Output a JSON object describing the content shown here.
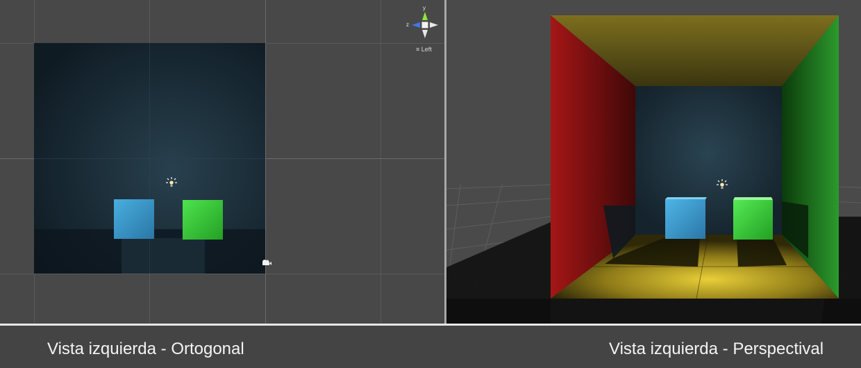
{
  "captions": {
    "left": "Vista izquierda - Ortogonal",
    "right": "Vista izquierda - Perspectival"
  },
  "gizmo": {
    "y_label": "y",
    "z_label": "z",
    "view_label": "Left",
    "view_menu_icon": "hamburger-menu-icon"
  },
  "colors": {
    "left_wall": "#a01414",
    "right_wall": "#1f8a1f",
    "ceiling_floor": "#d4b52a",
    "back_wall": "#1d3340",
    "blue_cube": "#3a9ad0",
    "green_cube": "#3fc43f",
    "gizmo_y": "#8ce63c",
    "gizmo_z": "#3c78e6"
  },
  "icons": {
    "light": "point-light-icon",
    "camera": "camera-icon"
  }
}
